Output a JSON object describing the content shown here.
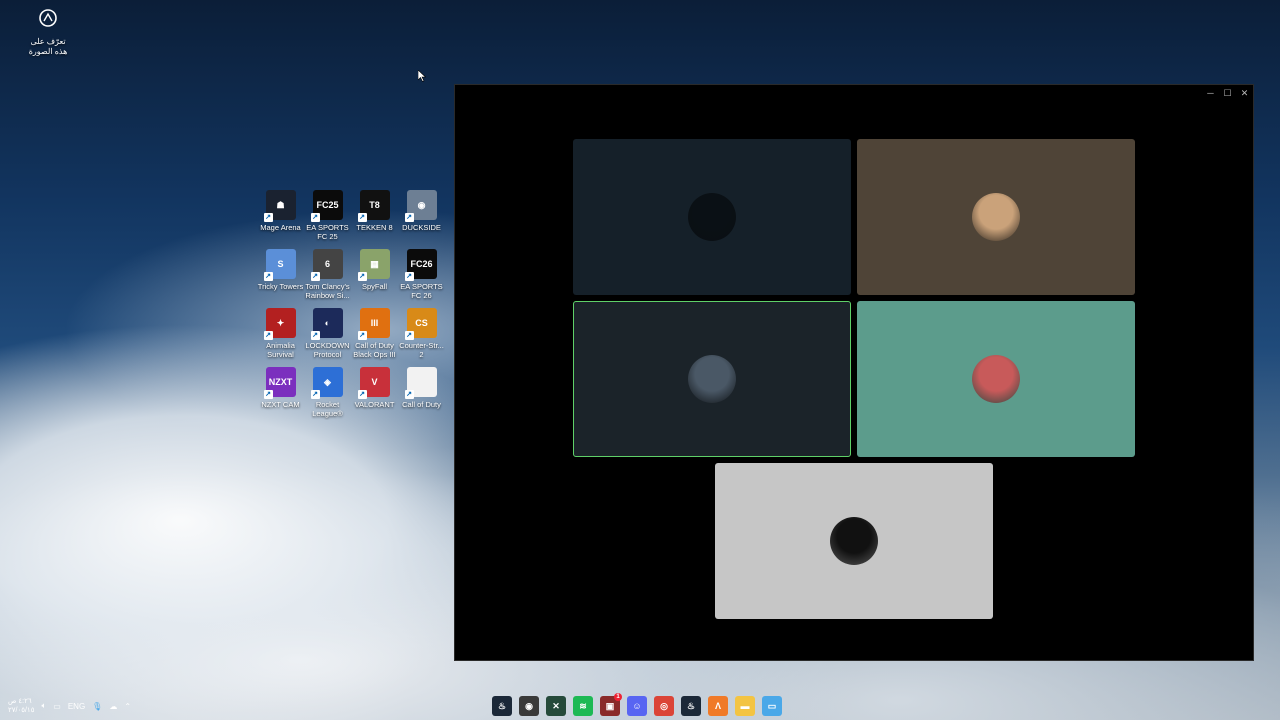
{
  "desktop": {
    "top_icon_label": "تعرّف على هذه الصورة",
    "icons": [
      {
        "label": "Mage Arena",
        "icon": "mage-arena-icon",
        "bg": "#1a2230",
        "glyph": "☗"
      },
      {
        "label": "EA SPORTS FC 25",
        "icon": "ea-fc25-icon",
        "bg": "#0b0b0b",
        "glyph": "FC25"
      },
      {
        "label": "TEKKEN 8",
        "icon": "tekken8-icon",
        "bg": "#111",
        "glyph": "T8"
      },
      {
        "label": "DUCKSIDE",
        "icon": "duckside-icon",
        "bg": "#6d7f94",
        "glyph": "◉"
      },
      {
        "label": "Tricky Towers",
        "icon": "tricky-towers-icon",
        "bg": "#5b8fd8",
        "glyph": "S"
      },
      {
        "label": "Tom Clancy's Rainbow Si...",
        "icon": "rainbow-six-icon",
        "bg": "#444",
        "glyph": "6"
      },
      {
        "label": "SpyFall",
        "icon": "spyfall-icon",
        "bg": "#8aa36a",
        "glyph": "▦"
      },
      {
        "label": "EA SPORTS FC 26",
        "icon": "ea-fc26-icon",
        "bg": "#0b0b0b",
        "glyph": "FC26"
      },
      {
        "label": "Animalia Survival",
        "icon": "animalia-icon",
        "bg": "#b32020",
        "glyph": "✦"
      },
      {
        "label": "LOCKDOWN Protocol",
        "icon": "lockdown-icon",
        "bg": "#1c2a5a",
        "glyph": "◐"
      },
      {
        "label": "Call of Duty Black Ops III",
        "icon": "cod-bo3-icon",
        "bg": "#e07010",
        "glyph": "III"
      },
      {
        "label": "Counter-Str... 2",
        "icon": "cs2-icon",
        "bg": "#d88a18",
        "glyph": "CS"
      },
      {
        "label": "NZXT CAM",
        "icon": "nzxt-cam-icon",
        "bg": "#7b2fbe",
        "glyph": "NZXT"
      },
      {
        "label": "Rocket League®",
        "icon": "rocket-league-icon",
        "bg": "#2d6fd6",
        "glyph": "◈"
      },
      {
        "label": "VALORANT",
        "icon": "valorant-icon",
        "bg": "#c8303a",
        "glyph": "V"
      },
      {
        "label": "Call of Duty",
        "icon": "cod-file-icon",
        "bg": "#f2f2f2",
        "glyph": ""
      }
    ]
  },
  "window": {
    "controls": {
      "minimize": "─",
      "maximize": "☐",
      "close": "✕"
    },
    "tiles": [
      {
        "name": "participant-tile-1",
        "bg": "#152029",
        "avatar": "#0a1015",
        "speaking": false
      },
      {
        "name": "participant-tile-2",
        "bg": "#4f4437",
        "avatar": "#caa27a",
        "speaking": false
      },
      {
        "name": "participant-tile-3",
        "bg": "#1b2329",
        "avatar": "#4a5866",
        "speaking": true
      },
      {
        "name": "participant-tile-4",
        "bg": "#5c9c8c",
        "avatar": "#c85a5a",
        "speaking": false
      },
      {
        "name": "participant-tile-5",
        "bg": "#c6c6c6",
        "avatar": "#111111",
        "speaking": false
      }
    ]
  },
  "taskbar": {
    "language": "ENG",
    "clock_time": "٤:٢٦ ص",
    "clock_date": "٢٧/٠٥/١٥",
    "apps": [
      {
        "icon": "steam-icon",
        "bg": "#1b2838",
        "glyph": "♨",
        "badge": ""
      },
      {
        "icon": "app-red-icon",
        "bg": "#3a3a3a",
        "glyph": "◉",
        "badge": ""
      },
      {
        "icon": "xbox-app-icon",
        "bg": "#254a3a",
        "glyph": "✕",
        "badge": ""
      },
      {
        "icon": "spotify-icon",
        "bg": "#1db954",
        "glyph": "≋",
        "badge": ""
      },
      {
        "icon": "notification-app-icon",
        "bg": "#8a2a2a",
        "glyph": "▣",
        "badge": "1"
      },
      {
        "icon": "discord-icon",
        "bg": "#5865f2",
        "glyph": "☺",
        "badge": ""
      },
      {
        "icon": "chrome-icon",
        "bg": "#db4437",
        "glyph": "◎",
        "badge": ""
      },
      {
        "icon": "steam-icon-2",
        "bg": "#1b2838",
        "glyph": "♨",
        "badge": ""
      },
      {
        "icon": "launcher-icon",
        "bg": "#f07a28",
        "glyph": "Λ",
        "badge": ""
      },
      {
        "icon": "file-explorer-icon",
        "bg": "#f3c443",
        "glyph": "▬",
        "badge": ""
      },
      {
        "icon": "window-app-icon",
        "bg": "#4aa8e8",
        "glyph": "▭",
        "badge": ""
      }
    ]
  }
}
